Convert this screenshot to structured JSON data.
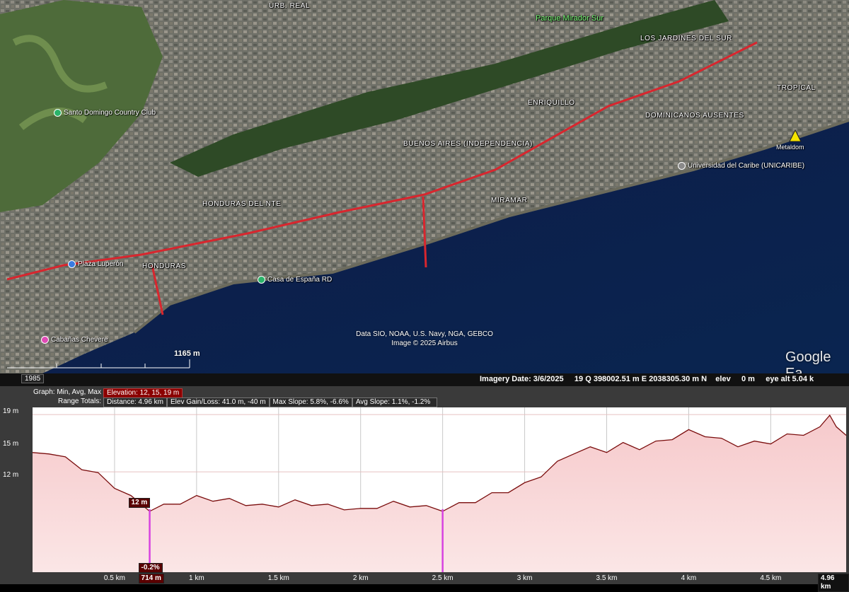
{
  "map": {
    "neighborhoods": {
      "urb_real": "URB. REAL",
      "parque": "Parque Mirador Sur",
      "jardines": "LOS JARDINES DEL SUR",
      "tropical": "TROPICAL",
      "enriquillo": "ENRIQUILLO",
      "dominicanos": "DOMINICANOS AUSENTES",
      "buenos_aires": "BUENOS AIRES (INDEPENDENCIA)",
      "honduras_nte": "HONDURAS DEL NTE",
      "miramar": "MIRAMAR",
      "honduras": "HONDURAS"
    },
    "pois": {
      "country_club": "Santo Domingo Country Club",
      "plaza_luperon": "Plaza Luperón",
      "casa_espana": "Casa de España RD",
      "cabanas": "Cabañas Chevere",
      "unicaribe": "Universidad del Caribe (UNICARIBE)",
      "metaldom": "Metaldom"
    },
    "attribution_line1": "Data SIO, NOAA, U.S. Navy, NGA, GEBCO",
    "attribution_line2": "Image © 2025 Airbus",
    "google_logo": "Google Ea",
    "scale_label": "1165 m",
    "colors": {
      "path": "#d8262e",
      "sea": "#0c1f4a"
    }
  },
  "statusbar": {
    "year": "1985",
    "imagery_date": "Imagery Date: 3/6/2025",
    "coords": "19 Q 398002.51 m E 2038305.30 m N",
    "elev_label": "elev",
    "elev_value": "0 m",
    "eye_alt": "eye alt  5.04 k"
  },
  "stats": {
    "graph_label": "Graph: Min, Avg, Max",
    "elevation": "Elevation: 12, 15, 19 m",
    "range_label": "Range Totals:",
    "distance": "Distance: 4.96 km",
    "gain_loss": "Elev Gain/Loss: 41.0 m, -40 m",
    "max_slope": "Max Slope: 5.8%, -6.6%",
    "avg_slope": "Avg Slope: 1.1%, -1.2%"
  },
  "chart_data": {
    "type": "area",
    "xlabel": "",
    "ylabel": "",
    "xlim": [
      0,
      4.96
    ],
    "ylim": [
      8,
      19.5
    ],
    "y_ticks": [
      "19 m",
      "15 m",
      "12 m"
    ],
    "x_ticks": [
      "0.5 km",
      "1 km",
      "1.5 km",
      "2 km",
      "2.5 km",
      "3 km",
      "3.5 km",
      "4 km",
      "4.5 km"
    ],
    "x_tick_values": [
      0.5,
      1,
      1.5,
      2,
      2.5,
      3,
      3.5,
      4,
      4.5
    ],
    "x_end_label": "4.96 km",
    "cursor_distance_label": "714 m",
    "cursor_elev_label": "12 m",
    "cursor_slope_label": "-0.2%",
    "markers_km": [
      0.714,
      2.5
    ],
    "x": [
      0,
      0.1,
      0.2,
      0.3,
      0.4,
      0.5,
      0.6,
      0.714,
      0.8,
      0.9,
      1.0,
      1.1,
      1.2,
      1.3,
      1.4,
      1.5,
      1.6,
      1.7,
      1.8,
      1.9,
      2.0,
      2.1,
      2.2,
      2.3,
      2.4,
      2.5,
      2.6,
      2.7,
      2.8,
      2.9,
      3.0,
      3.1,
      3.2,
      3.3,
      3.4,
      3.5,
      3.6,
      3.7,
      3.8,
      3.9,
      4.0,
      4.1,
      4.2,
      4.3,
      4.4,
      4.5,
      4.6,
      4.7,
      4.8,
      4.86,
      4.9,
      4.96
    ],
    "y": [
      16.2,
      16.4,
      15.9,
      15.3,
      14.8,
      14.0,
      13.2,
      12.4,
      12.6,
      12.9,
      13.2,
      13.1,
      13.0,
      12.8,
      12.6,
      12.7,
      12.9,
      12.8,
      12.6,
      12.5,
      12.3,
      12.6,
      12.8,
      12.7,
      12.5,
      12.4,
      12.7,
      13.0,
      13.4,
      13.7,
      14.1,
      14.8,
      15.6,
      16.4,
      16.6,
      16.5,
      16.9,
      16.7,
      17.0,
      17.4,
      17.8,
      17.6,
      17.2,
      16.9,
      17.0,
      17.1,
      17.5,
      17.7,
      18.0,
      19.1,
      18.0,
      17.7
    ]
  }
}
